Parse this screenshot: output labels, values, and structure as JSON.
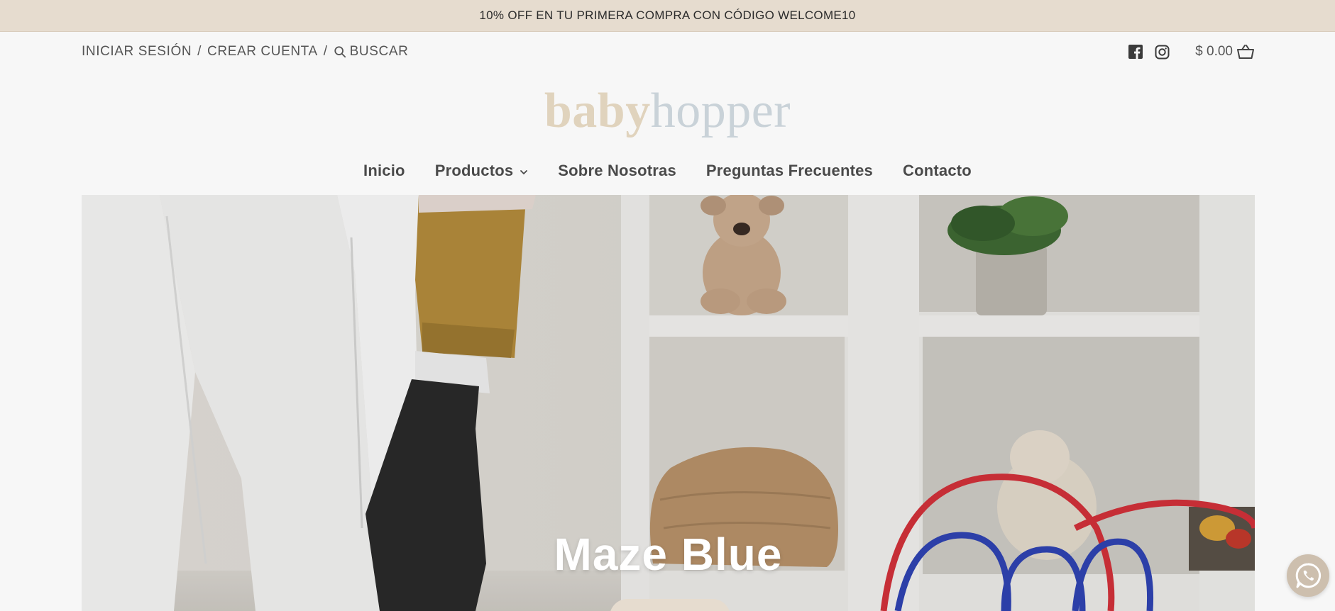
{
  "announcement": {
    "text": "10% OFF EN TU PRIMERA COMPRA CON CÓDIGO WELCOME10"
  },
  "utility": {
    "login": "INICIAR SESIÓN",
    "sep1": "/",
    "create_account": "CREAR CUENTA",
    "sep2": "/",
    "search": "BUSCAR"
  },
  "header": {
    "cart_total": "$ 0.00",
    "social": [
      "facebook-icon",
      "instagram-icon"
    ]
  },
  "logo": {
    "part1": "baby",
    "part2": "hopper"
  },
  "nav": {
    "items": [
      {
        "label": "Inicio"
      },
      {
        "label": "Productos",
        "has_dropdown": true
      },
      {
        "label": "Sobre Nosotras"
      },
      {
        "label": "Preguntas Frecuentes"
      },
      {
        "label": "Contacto"
      }
    ]
  },
  "hero": {
    "title": "Maze Blue"
  },
  "colors": {
    "announcement_bg": "#e6dccf",
    "logo_baby": "#e0d3bd",
    "logo_hopper": "#c9d2d8",
    "whatsapp_bg": "#cdbfae"
  }
}
